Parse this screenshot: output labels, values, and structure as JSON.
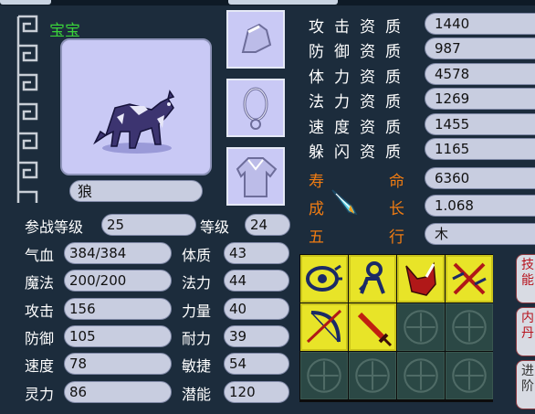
{
  "pet": {
    "header": "宝宝",
    "name": "狼"
  },
  "left_stats": {
    "battle_level_label": "参战等级",
    "battle_level_value": "25",
    "level_label": "等级",
    "level_value": "24",
    "hp_label": "气血",
    "hp_value": "384/384",
    "mp_label": "魔法",
    "mp_value": "200/200",
    "attack_label": "攻击",
    "attack_value": "156",
    "defense_label": "防御",
    "defense_value": "105",
    "speed_label": "速度",
    "speed_value": "78",
    "spirit_label": "灵力",
    "spirit_value": "86",
    "constitution_label": "体质",
    "constitution_value": "43",
    "magic_label": "法力",
    "magic_value": "44",
    "strength_label": "力量",
    "strength_value": "40",
    "endurance_label": "耐力",
    "endurance_value": "39",
    "agility_label": "敏捷",
    "agility_value": "54",
    "potential_label": "潜能",
    "potential_value": "120"
  },
  "aptitudes": {
    "attack_label": "攻击资质",
    "attack_value": "1440",
    "defense_label": "防御资质",
    "defense_value": "987",
    "stamina_label": "体力资质",
    "stamina_value": "4578",
    "magic_label": "法力资质",
    "magic_value": "1269",
    "speed_label": "速度资质",
    "speed_value": "1455",
    "dodge_label": "躲闪资质",
    "dodge_value": "1165",
    "life_label_1": "寿",
    "life_label_2": "命",
    "life_value": "6360",
    "growth_label_1": "成",
    "growth_label_2": "长",
    "growth_value": "1.068",
    "element_label_1": "五",
    "element_label_2": "行",
    "element_value": "木"
  },
  "side_tabs": {
    "skills": "技能",
    "inner_pill": "内丹",
    "advance": "进阶"
  },
  "colors": {
    "panel_bg": "#1c2c3c",
    "pill_bg": "#c8cde0",
    "portrait_bg": "#c9c9f5",
    "title_green": "#3ad23a",
    "accent_orange": "#f07c12",
    "skill_yellow": "#e8e428"
  },
  "skills": [
    {
      "icon": "eye-icon",
      "active": true
    },
    {
      "icon": "figure-icon",
      "active": true
    },
    {
      "icon": "shield-claw-icon",
      "active": true
    },
    {
      "icon": "crossed-swords-icon",
      "active": true
    },
    {
      "icon": "bow-icon",
      "active": true
    },
    {
      "icon": "sword-icon",
      "active": true
    },
    {
      "icon": "empty-slot-icon",
      "active": false
    },
    {
      "icon": "empty-slot-icon",
      "active": false
    },
    {
      "icon": "empty-slot-icon",
      "active": false
    },
    {
      "icon": "empty-slot-icon",
      "active": false
    },
    {
      "icon": "empty-slot-icon",
      "active": false
    },
    {
      "icon": "empty-slot-icon",
      "active": false
    }
  ]
}
